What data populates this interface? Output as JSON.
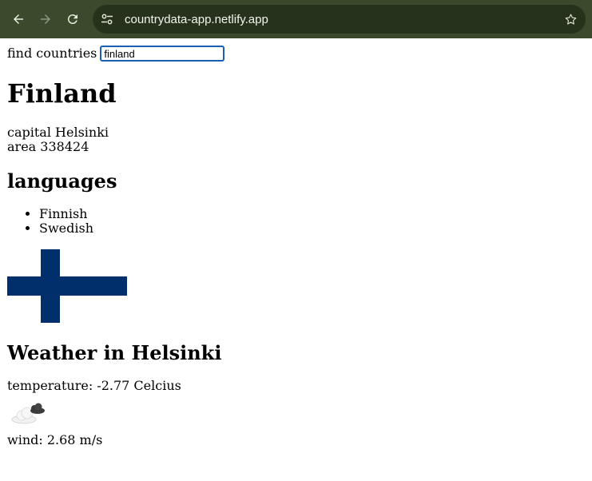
{
  "browser": {
    "url": "countrydata-app.netlify.app"
  },
  "search": {
    "label": "find countries",
    "value": "finland"
  },
  "country": {
    "name": "Finland",
    "capital_label": "capital",
    "capital": "Helsinki",
    "area_label": "area",
    "area": "338424",
    "languages_heading": "languages",
    "languages": [
      "Finnish",
      "Swedish"
    ],
    "flag": {
      "background": "#ffffff",
      "cross": "#002f6c"
    }
  },
  "weather": {
    "heading": "Weather in Helsinki",
    "temperature_text": "temperature: -2.77 Celcius",
    "icon": "cloud-icon",
    "wind_text": "wind: 2.68 m/s"
  }
}
